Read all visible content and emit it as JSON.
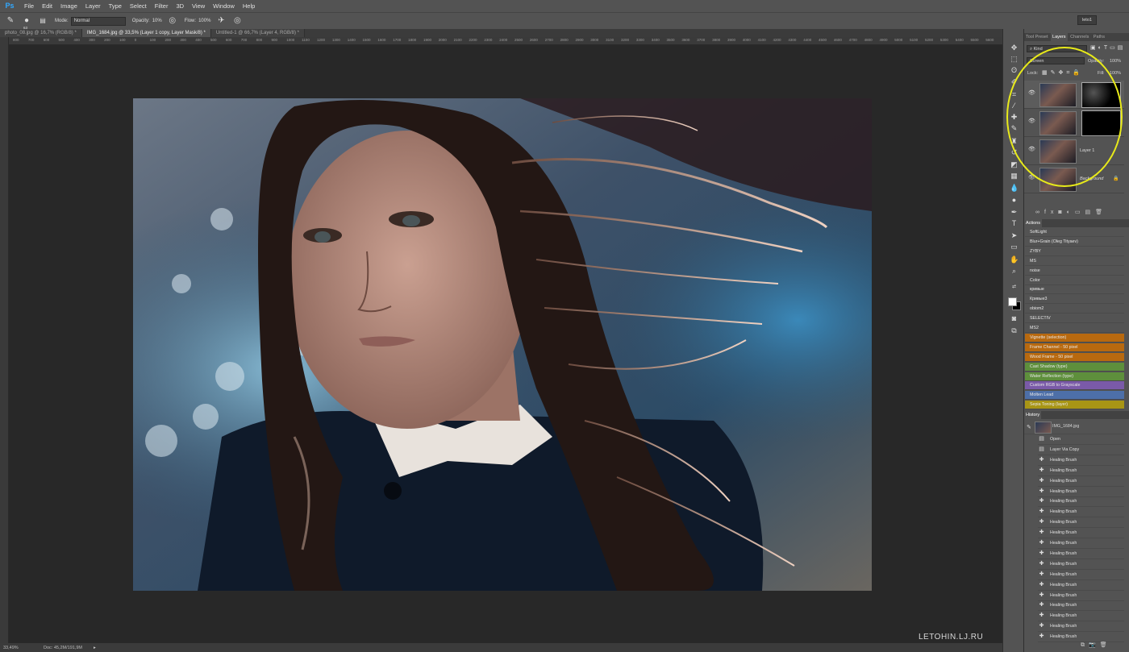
{
  "menubar": {
    "logo": "Ps",
    "items": [
      "File",
      "Edit",
      "Image",
      "Layer",
      "Type",
      "Select",
      "Filter",
      "3D",
      "View",
      "Window",
      "Help"
    ]
  },
  "options": {
    "brush_size": "63",
    "mode_label": "Mode:",
    "mode_value": "Normal",
    "opacity_label": "Opacity:",
    "opacity_value": "10%",
    "flow_label": "Flow:",
    "flow_value": "100%",
    "workspace": "leto1"
  },
  "tabs": [
    {
      "label": "photo_08.jpg @ 16,7% (RGB/8) *"
    },
    {
      "label": "IMG_1684.jpg @ 33,5% (Layer 1 copy, Layer Mask/8) *"
    },
    {
      "label": "Untitled-1 @ 66,7% (Layer 4, RGB/8) *"
    }
  ],
  "ruler_ticks": [
    "800",
    "700",
    "600",
    "500",
    "400",
    "300",
    "200",
    "100",
    "0",
    "100",
    "200",
    "300",
    "400",
    "500",
    "600",
    "700",
    "800",
    "900",
    "1000",
    "1100",
    "1200",
    "1300",
    "1400",
    "1500",
    "1600",
    "1700",
    "1800",
    "1900",
    "2000",
    "2100",
    "2200",
    "2300",
    "2400",
    "2500",
    "2600",
    "2700",
    "2800",
    "2900",
    "3000",
    "3100",
    "3200",
    "3300",
    "3400",
    "3500",
    "3600",
    "3700",
    "3800",
    "3900",
    "4000",
    "4100",
    "4200",
    "4300",
    "4400",
    "4500",
    "4600",
    "4700",
    "4800",
    "4900",
    "5000",
    "5100",
    "5200",
    "5300",
    "5400",
    "5500",
    "5600"
  ],
  "status": {
    "zoom": "33,49%",
    "doc": "Doc: 45,2M/191,9M"
  },
  "watermark": "LETOHIN.LJ.RU",
  "layers_panel": {
    "tabs": [
      "Tool Preset",
      "Layers",
      "Channels",
      "Paths"
    ],
    "filter_kind": "Kind",
    "blend_mode": "Screen",
    "opacity_label": "Opacity:",
    "opacity_value": "100%",
    "lock_label": "Lock:",
    "fill_label": "Fill:",
    "fill_value": "100%",
    "layers": [
      {
        "name": ""
      },
      {
        "name": ""
      },
      {
        "name": "Layer 1"
      },
      {
        "name": "Background"
      }
    ]
  },
  "actions_panel": {
    "title": "Actions",
    "items": [
      {
        "label": "SoftLight",
        "color": ""
      },
      {
        "label": "Blur+Grain (Oleg Tityaev)",
        "color": ""
      },
      {
        "label": "ZYBY",
        "color": ""
      },
      {
        "label": "MS",
        "color": ""
      },
      {
        "label": "noise",
        "color": ""
      },
      {
        "label": "Color",
        "color": ""
      },
      {
        "label": "кривые",
        "color": ""
      },
      {
        "label": "Кривые3",
        "color": ""
      },
      {
        "label": "obiom2",
        "color": ""
      },
      {
        "label": "SELECTIV",
        "color": ""
      },
      {
        "label": "MS2",
        "color": ""
      },
      {
        "label": "Vignette (selection)",
        "color": "#b8690f"
      },
      {
        "label": "Frame Channel - 50 pixel",
        "color": "#b8690f"
      },
      {
        "label": "Wood Frame - 50 pixel",
        "color": "#b8690f"
      },
      {
        "label": "Cast Shadow (type)",
        "color": "#5e8f3c"
      },
      {
        "label": "Water Reflection (type)",
        "color": "#5e8f3c"
      },
      {
        "label": "Custom RGB to Grayscale",
        "color": "#7a5aa8"
      },
      {
        "label": "Molten Lead",
        "color": "#4d6fa8"
      },
      {
        "label": "Sepia Toning (layer)",
        "color": "#a89515"
      }
    ]
  },
  "history_panel": {
    "title": "History",
    "snapshot": "IMG_1684.jpg",
    "items": [
      "Open",
      "Layer Via Copy",
      "Healing Brush",
      "Healing Brush",
      "Healing Brush",
      "Healing Brush",
      "Healing Brush",
      "Healing Brush",
      "Healing Brush",
      "Healing Brush",
      "Healing Brush",
      "Healing Brush",
      "Healing Brush",
      "Healing Brush",
      "Healing Brush",
      "Healing Brush",
      "Healing Brush",
      "Healing Brush",
      "Healing Brush",
      "Healing Brush"
    ]
  },
  "colors": {
    "accent": "#31a8ff",
    "highlight_ring": "#e8ea1a"
  }
}
